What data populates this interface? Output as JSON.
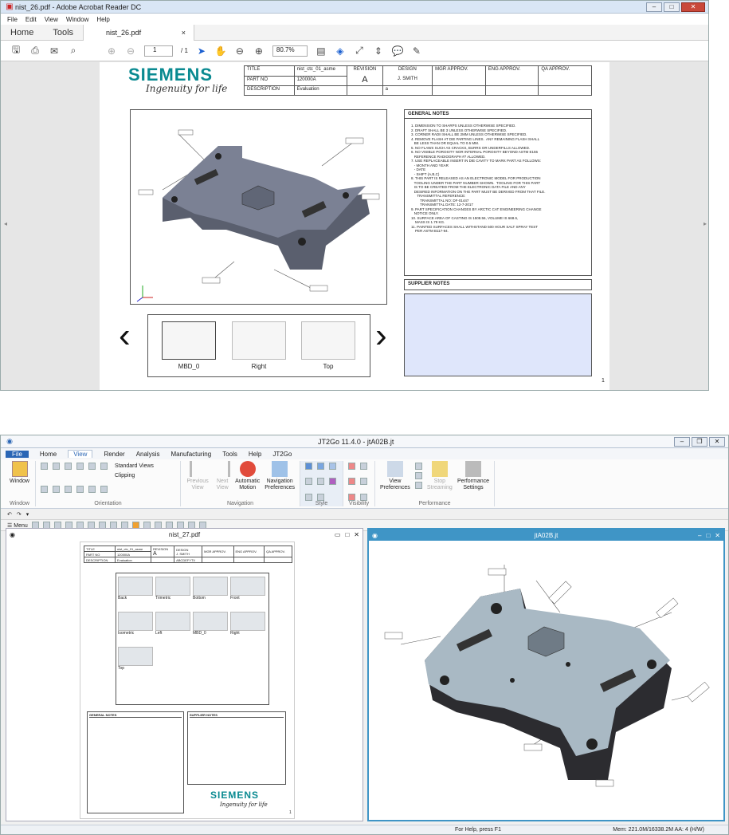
{
  "acrobat": {
    "title": "nist_26.pdf - Adobe Acrobat Reader DC",
    "menu": [
      "File",
      "Edit",
      "View",
      "Window",
      "Help"
    ],
    "tabs": {
      "home": "Home",
      "tools": "Tools",
      "doc": "nist_26.pdf",
      "close": "×"
    },
    "toolbar": {
      "page": "1",
      "page_total": "/ 1",
      "zoom": "80.7%"
    },
    "page": {
      "brand": "SIEMENS",
      "tagline": "Ingenuity for life",
      "title_block": {
        "title_label": "TITLE",
        "title_value": "nist_ctc_01_asme",
        "part_label": "PART NO",
        "part_value": "120000A",
        "desc_label": "DESCRIPTION",
        "desc_value": "Evaluation",
        "revision_label": "REVISION",
        "revision_value": "A",
        "design_label": "DESIGN",
        "design_value": "J. SMITH",
        "design_extra": "a",
        "mgr": "MGR APPROV.",
        "eng": "ENG APPROV.",
        "qa": "QA APPROV."
      },
      "general_notes_title": "GENERAL NOTES",
      "general_notes": "1. DIMENSION TO SHARPS UNLESS OTHERWISE SPECIFIED.\n2. DRAFT SHALL BE 3 UNLESS OTHERWISE SPECIFIED.\n3. CORNER RADII SHALL BE 2MM UNLESS OTHERWISE SPECIFIED.\n4. REMOVE FLASH AT DIE PARTING LINES.  ANY REMAINING FLASH SHALL\n   BE LESS THAN OR EQUAL TO 0.5 MM.\n5. NO FLAWS SUCH AS CRACKS, BURRS OR UNDERFILLS ALLOWED.\n6. NO VISIBLE POROSITY NOR INTERNAL POROSITY BEYOND ASTM E155\n   REFERENCE RADIOGRAPH #7 ALLOWED.\n7. USE REPLACEABLE INSERT IN DIE CAVITY TO MARK PART AS FOLLOWS:\n   - MONTH AND YEAR\n   - DATE\n   - SHIFT (A,B,C)\n8. THIS PART IS RELEASED AS AN ELECTRONIC MODEL FOR PRODUCTION\n   TOOLING UNDER THE PART NUMBER SHOWN.  TOOLING FOR THIS PART\n   IS TO BE CREATED FROM THE ELECTRONIC DATA FILE AND ANY\n   DESIRED INFORMATION ON THE PART MUST BE DERIVED FROM THAT FILE.\n      TRANSMITTAL REFERENCE:\n         TRANSMITTAL NO: DF-01447\n         TRANSMITTAL DATE: 12-7-2017\n9. PART SPECIFICATION CHANGES BY ARCTIC CAT ENGINEERING CHANGE\n   NOTICE ONLY.\n10. SURFACE AREA OF CASTING IS 1508.56, VOLUME IS 668.6,\n    MASS IS 1.79 KG.\n11. PAINTED SURFACES SHALL WITHSTAND 500 HOUR SALT SPRAY TEST\n    PER ASTM B117-94.",
      "supplier_notes_title": "SUPPLIER NOTES",
      "thumbs": [
        "MBD_0",
        "Right",
        "Top"
      ],
      "page_number": "1"
    }
  },
  "jt": {
    "title": "JT2Go 11.4.0 - jtA02B.jt",
    "ribbon_tabs": [
      "File",
      "Home",
      "View",
      "Render",
      "Analysis",
      "Manufacturing",
      "Tools",
      "Help",
      "JT2Go"
    ],
    "groups": {
      "window": {
        "btn": "Window",
        "label": "Window"
      },
      "orientation": {
        "label": "Orientation",
        "standard_views": "Standard Views",
        "clipping": "Clipping"
      },
      "navigation": {
        "label": "Navigation",
        "prev": "Previous View",
        "next": "Next View",
        "auto": "Automatic Motion",
        "prefs": "Navigation Preferences"
      },
      "style": {
        "label": "Style"
      },
      "visibility": {
        "label": "Visibility"
      },
      "performance": {
        "label": "Performance",
        "view_prefs": "View Preferences",
        "stop": "Stop Streaming",
        "perf": "Performance Settings"
      }
    },
    "menu_label": "Menu",
    "left_pane": {
      "title": "nist_27.pdf",
      "mini_title": {
        "title": "TITLE",
        "title_v": "nist_ctc_01_asme",
        "part": "PART NO",
        "part_v": "120000A",
        "desc": "DESCRIPTION",
        "desc_v": "Evaluation",
        "rev": "REVISION",
        "rev_v": "A",
        "design": "DESIGN",
        "design_v": "J. SMITH",
        "design_v2": "ABCDEFYTV",
        "mgr": "MGR APPROV.",
        "eng": "ENG APPROV.",
        "qa": "QA APPROV."
      },
      "views": [
        "Back",
        "Trimetric",
        "Bottom",
        "Front",
        "Isometric",
        "Left",
        "MBD_0",
        "Right",
        "Top"
      ],
      "general_notes": "GENERAL NOTES",
      "supplier_notes": "SUPPLIER NOTES",
      "brand": "SIEMENS",
      "tagline": "Ingenuity for life",
      "page_num": "1"
    },
    "right_pane": {
      "title": "jtA02B.jt"
    },
    "status": {
      "help": "For Help, press F1",
      "mem": "Mem: 221.0M/16338.2M  AA: 4 (H/W)"
    }
  }
}
